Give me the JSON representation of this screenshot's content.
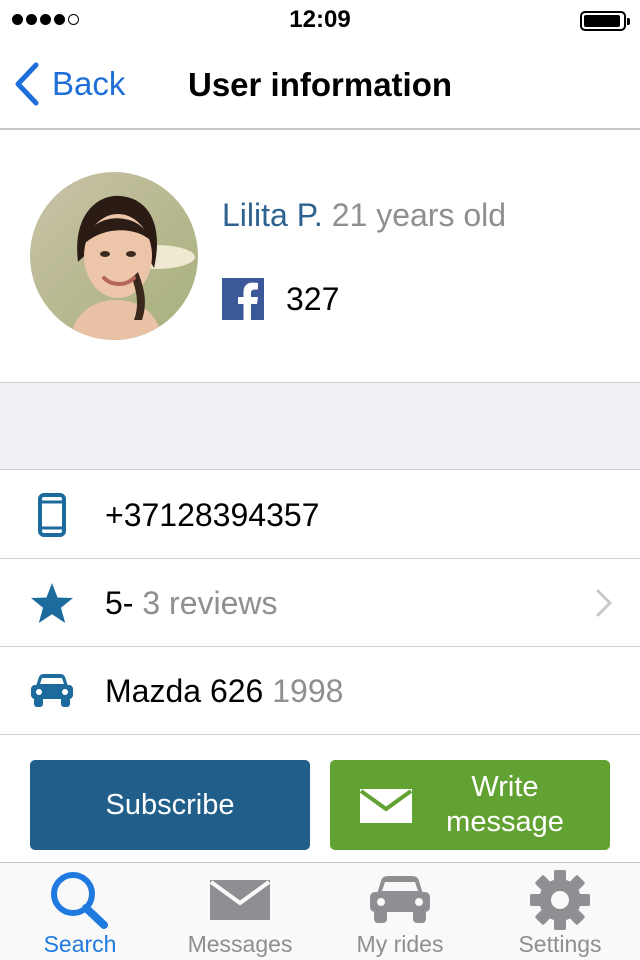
{
  "status_bar": {
    "time": "12:09"
  },
  "nav": {
    "back_label": "Back",
    "title": "User information"
  },
  "profile": {
    "name": "Lilita P.",
    "age": "21 years old",
    "facebook_friends": "327"
  },
  "contact": {
    "phone": "+37128394357",
    "rating": "5-",
    "reviews": "3 reviews",
    "car_model": "Mazda 626",
    "car_year": "1998"
  },
  "actions": {
    "subscribe_label": "Subscribe",
    "write_line1": "Write",
    "write_line2": "message"
  },
  "tabs": [
    {
      "label": "Search",
      "icon": "search-icon",
      "active": true
    },
    {
      "label": "Messages",
      "icon": "envelope-icon",
      "active": false
    },
    {
      "label": "My rides",
      "icon": "car-icon",
      "active": false
    },
    {
      "label": "Settings",
      "icon": "gear-icon",
      "active": false
    }
  ],
  "colors": {
    "accent_blue": "#1f6fd8",
    "name_blue": "#2d6290",
    "subscribe_button": "#215f8a",
    "write_button": "#62a233",
    "facebook": "#3b5998",
    "icon_blue": "#1d6a9c"
  }
}
